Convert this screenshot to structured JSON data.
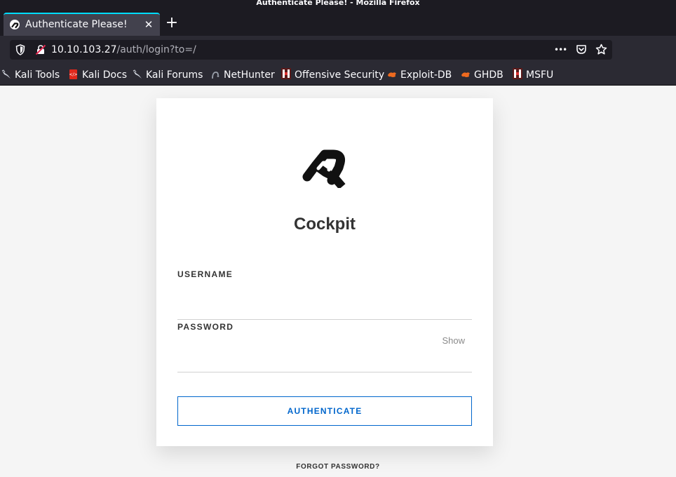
{
  "window": {
    "title": "Authenticate Please! - Mozilla Firefox"
  },
  "tab": {
    "title": "Authenticate Please!",
    "close_glyph": "✕",
    "new_tab_glyph": "+"
  },
  "urlbar": {
    "host": "10.10.103.27",
    "path": "/auth/login?to=/",
    "menu_glyph": "•••"
  },
  "bookmarks": [
    {
      "label": "Kali Tools",
      "icon": "kali-dragon-icon"
    },
    {
      "label": "Kali Docs",
      "icon": "kali-docs-icon"
    },
    {
      "label": "Kali Forums",
      "icon": "kali-dragon-icon"
    },
    {
      "label": "NetHunter",
      "icon": "nethunter-icon"
    },
    {
      "label": "Offensive Security",
      "icon": "offsec-icon"
    },
    {
      "label": "Exploit-DB",
      "icon": "exploit-db-icon"
    },
    {
      "label": "GHDB",
      "icon": "exploit-db-icon"
    },
    {
      "label": "MSFU",
      "icon": "offsec-icon"
    }
  ],
  "login": {
    "brand": "Cockpit",
    "username_label": "USERNAME",
    "username_value": "",
    "password_label": "PASSWORD",
    "password_value": "",
    "show_label": "Show",
    "authenticate_label": "AUTHENTICATE",
    "forgot_label": "FORGOT PASSWORD?"
  },
  "colors": {
    "accent": "#0066cc",
    "tab_highlight": "#00ddff",
    "chrome_dark": "#1c1b22",
    "chrome": "#2b2a33"
  }
}
